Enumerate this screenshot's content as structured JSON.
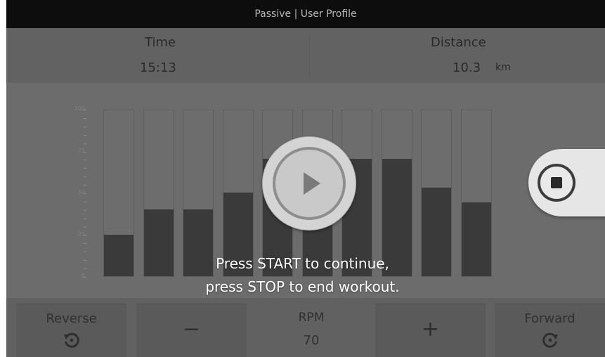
{
  "title_bar": {
    "text": "Passive | User Profile"
  },
  "stats": {
    "time": {
      "label": "Time",
      "value": "15:13"
    },
    "distance": {
      "label": "Distance",
      "value": "10.3",
      "unit": "km"
    }
  },
  "chart_data": {
    "type": "bar",
    "title": "",
    "ylim": [
      0,
      100
    ],
    "yticks": [
      "100",
      "75",
      "50",
      "25",
      "0"
    ],
    "values": [
      25,
      40,
      40,
      50,
      70,
      70,
      70,
      70,
      53,
      44
    ]
  },
  "controls": {
    "reverse": {
      "label": "Reverse",
      "icon": "rotate-ccw-icon"
    },
    "minus": {
      "label": "−"
    },
    "rpm": {
      "label": "RPM",
      "value": "70"
    },
    "plus": {
      "label": "+"
    },
    "forward": {
      "label": "Forward",
      "icon": "rotate-cw-icon"
    }
  },
  "overlay": {
    "play_icon": "play-icon",
    "stop_icon": "stop-icon",
    "prompt_line1": "Press START to continue,",
    "prompt_line2": "press STOP to end workout."
  }
}
